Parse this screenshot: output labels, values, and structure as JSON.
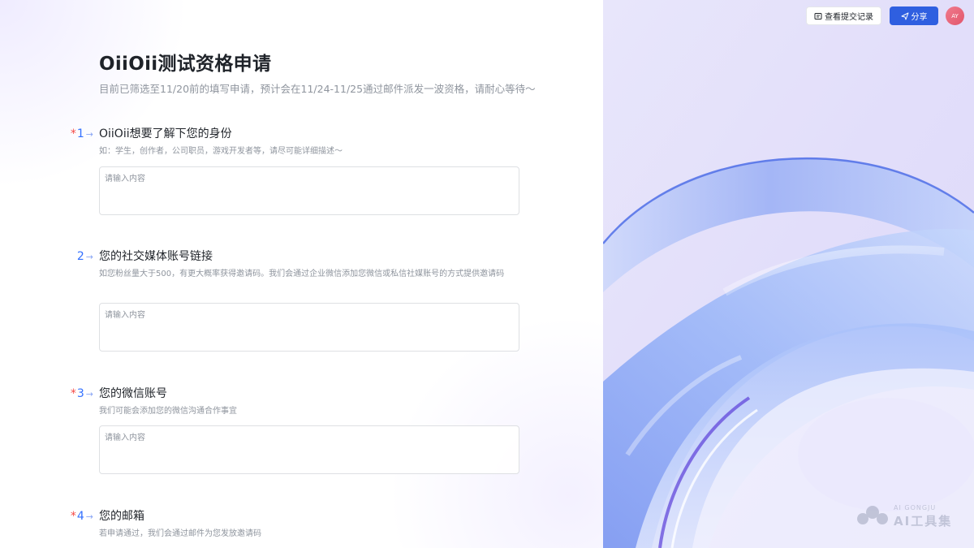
{
  "form": {
    "title": "OiiOii测试资格申请",
    "subtitle": "目前已筛选至11/20前的填写申请，预计会在11/24-11/25通过邮件派发一波资格，请耐心等待～",
    "questions": [
      {
        "required": "*",
        "number": "1",
        "arrow": "→",
        "title": "OiiOii想要了解下您的身份",
        "description": "如：学生，创作者，公司职员，游戏开发者等，请尽可能详细描述～",
        "placeholder": "请输入内容"
      },
      {
        "required": "",
        "number": "2",
        "arrow": "→",
        "title": "您的社交媒体账号链接",
        "description": "如您粉丝量大于500，有更大概率获得邀请码。我们会通过企业微信添加您微信或私信社媒账号的方式提供邀请码",
        "placeholder": "请输入内容"
      },
      {
        "required": "*",
        "number": "3",
        "arrow": "→",
        "title": "您的微信账号",
        "description": "我们可能会添加您的微信沟通合作事宜",
        "placeholder": "请输入内容"
      },
      {
        "required": "*",
        "number": "4",
        "arrow": "→",
        "title": "您的邮箱",
        "description": "若申请通过，我们会通过邮件为您发放邀请码"
      }
    ]
  },
  "header": {
    "records_label": "查看提交记录",
    "records_icon": "records-icon",
    "share_label": "分享",
    "share_icon": "send-icon",
    "avatar_initials": "AY"
  },
  "watermark": {
    "small": "AI GONGJU",
    "big": "AI工具集"
  },
  "colors": {
    "accent": "#3370ff",
    "required": "#f54a45",
    "share_button": "#2f5fe0",
    "deco_background": "#e4e0fb"
  }
}
